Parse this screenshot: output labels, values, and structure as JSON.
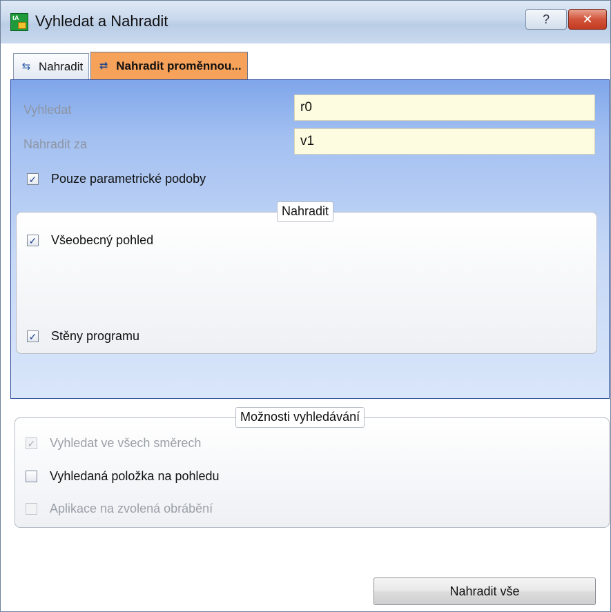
{
  "window": {
    "title": "Vyhledat a Nahradit",
    "help_label": "?",
    "close_label": "✕"
  },
  "tabs": [
    {
      "label": "Nahradit",
      "active": false
    },
    {
      "label": "Nahradit proměnnou...",
      "active": true
    }
  ],
  "replace_panel": {
    "search_label": "Vyhledat",
    "search_value": "r0",
    "replace_label": "Nahradit za",
    "replace_value": "v1",
    "parametric_only": {
      "label": "Pouze parametrické podoby",
      "checked": true
    },
    "group": {
      "title": "Nahradit",
      "general_view": {
        "label": "Všeobecný pohled",
        "checked": true
      },
      "program_faces": {
        "label": "Stěny programu",
        "checked": true
      }
    }
  },
  "search_options": {
    "title": "Možnosti vyhledávání",
    "all_directions": {
      "label": "Vyhledat ve všech směrech",
      "checked": true,
      "enabled": false
    },
    "found_item_in_view": {
      "label": "Vyhledaná položka na pohledu",
      "checked": false,
      "enabled": true
    },
    "apply_selected": {
      "label": "Aplikace na zvolená obrábění",
      "checked": false,
      "enabled": false
    }
  },
  "footer": {
    "replace_all_label": "Nahradit vše"
  },
  "colors": {
    "active_tab": "#f7a25a",
    "panel_gradient_top": "#7fa6ea",
    "panel_gradient_bottom": "#d9e6fa",
    "input_bg": "#fefce0",
    "close_button": "#c43a22"
  }
}
